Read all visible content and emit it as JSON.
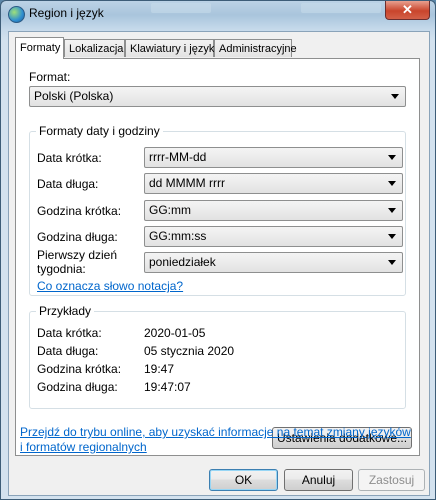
{
  "window": {
    "title": "Region i język",
    "close_glyph": "✕"
  },
  "tabs": [
    {
      "label": "Formaty"
    },
    {
      "label": "Lokalizacja"
    },
    {
      "label": "Klawiatury i języki"
    },
    {
      "label": "Administracyjne"
    }
  ],
  "format": {
    "label": "Format:",
    "value": "Polski (Polska)"
  },
  "date_time_formats": {
    "title": "Formaty daty i godziny",
    "rows": [
      {
        "label": "Data krótka:",
        "value": "rrrr-MM-dd"
      },
      {
        "label": "Data długa:",
        "value": "dd MMMM rrrr"
      },
      {
        "label": "Godzina krótka:",
        "value": "GG:mm"
      },
      {
        "label": "Godzina długa:",
        "value": "GG:mm:ss"
      },
      {
        "label": "Pierwszy dzień tygodnia:",
        "value": "poniedziałek"
      }
    ],
    "notation_link": "Co oznacza słowo notacja?"
  },
  "examples": {
    "title": "Przykłady",
    "rows": [
      {
        "label": "Data krótka:",
        "value": "2020-01-05"
      },
      {
        "label": "Data długa:",
        "value": "05 stycznia 2020"
      },
      {
        "label": "Godzina krótka:",
        "value": "19:47"
      },
      {
        "label": "Godzina długa:",
        "value": "19:47:07"
      }
    ]
  },
  "additional_settings_button": "Ustawienia dodatkowe...",
  "online_link": "Przejdź do trybu online, aby uzyskać informacje na temat zmiany języków i formatów regionalnych",
  "buttons": {
    "ok": "OK",
    "cancel": "Anuluj",
    "apply": "Zastosuj"
  }
}
